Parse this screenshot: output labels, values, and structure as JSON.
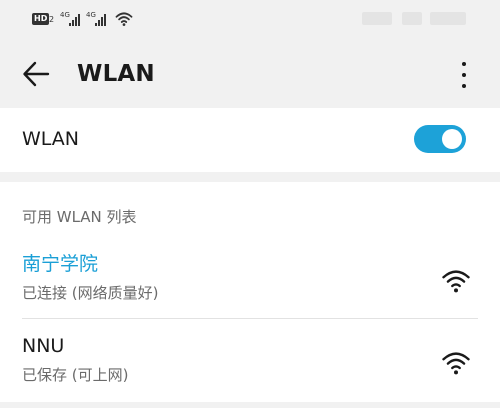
{
  "status_bar": {
    "hd_label": "HD",
    "hd_sub": "2",
    "network_type_1": "4G",
    "network_type_2": "4G"
  },
  "header": {
    "title": "WLAN"
  },
  "wlan_toggle": {
    "label": "WLAN",
    "on": true,
    "color": "#1da2d8"
  },
  "networks": {
    "section_title": "可用 WLAN 列表",
    "items": [
      {
        "name": "南宁学院",
        "status": "已连接 (网络质量好)",
        "connected": true,
        "icon": "wifi-icon"
      },
      {
        "name": "NNU",
        "status": "已保存 (可上网)",
        "connected": false,
        "icon": "wifi-icon"
      }
    ]
  },
  "colors": {
    "accent": "#1a9fd6",
    "background": "#f1f1f1"
  }
}
